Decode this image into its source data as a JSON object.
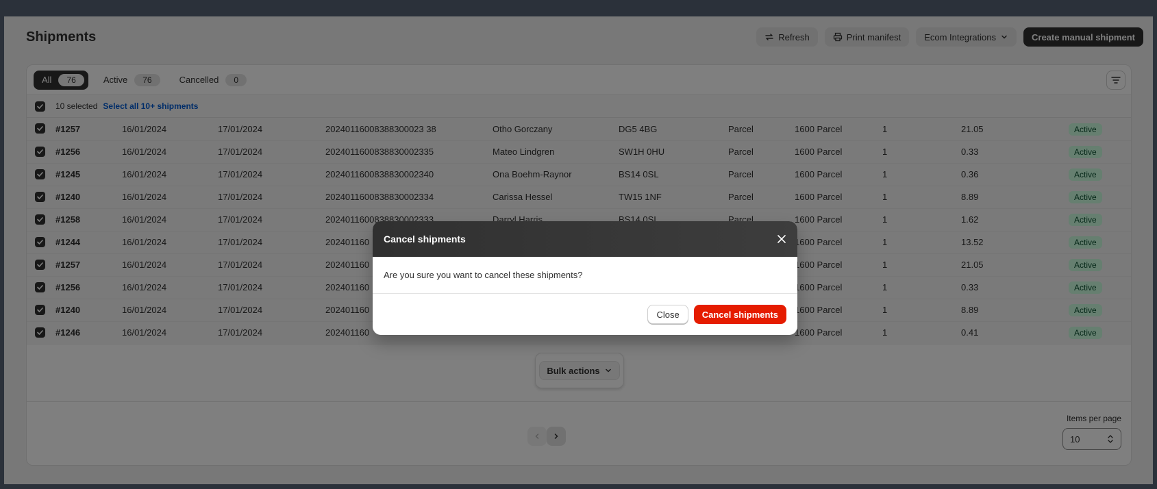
{
  "page": {
    "title": "Shipments"
  },
  "header": {
    "refresh_label": "Refresh",
    "print_label": "Print manifest",
    "integrations_label": "Ecom Integrations",
    "create_label": "Create manual shipment"
  },
  "tabs": [
    {
      "label": "All",
      "count": "76"
    },
    {
      "label": "Active",
      "count": "76"
    },
    {
      "label": "Cancelled",
      "count": "0"
    }
  ],
  "selection": {
    "selected_text": "10 selected",
    "select_all_label": "Select all 10+ shipments"
  },
  "rows": [
    {
      "order": "#1257",
      "created": "16/01/2024",
      "date": "17/01/2024",
      "tracking": "20240116008388300023 38",
      "customer": "Otho Gorczany",
      "postcode": "DG5 4BG",
      "type": "Parcel",
      "service": "1600 Parcel",
      "qty": "1",
      "weight": "21.05",
      "status": "Active"
    },
    {
      "order": "#1256",
      "created": "16/01/2024",
      "date": "17/01/2024",
      "tracking": "2024011600838830002335",
      "customer": "Mateo Lindgren",
      "postcode": "SW1H 0HU",
      "type": "Parcel",
      "service": "1600 Parcel",
      "qty": "1",
      "weight": "0.33",
      "status": "Active"
    },
    {
      "order": "#1245",
      "created": "16/01/2024",
      "date": "17/01/2024",
      "tracking": "2024011600838830002340",
      "customer": "Ona Boehm-Raynor",
      "postcode": "BS14 0SL",
      "type": "Parcel",
      "service": "1600 Parcel",
      "qty": "1",
      "weight": "0.36",
      "status": "Active"
    },
    {
      "order": "#1240",
      "created": "16/01/2024",
      "date": "17/01/2024",
      "tracking": "2024011600838830002334",
      "customer": "Carissa Hessel",
      "postcode": "TW15 1NF",
      "type": "Parcel",
      "service": "1600 Parcel",
      "qty": "1",
      "weight": "8.89",
      "status": "Active"
    },
    {
      "order": "#1258",
      "created": "16/01/2024",
      "date": "17/01/2024",
      "tracking": "2024011600838830002333",
      "customer": "Darryl Harris",
      "postcode": "BS14 0SL",
      "type": "Parcel",
      "service": "1600 Parcel",
      "qty": "1",
      "weight": "1.62",
      "status": "Active"
    },
    {
      "order": "#1244",
      "created": "16/01/2024",
      "date": "17/01/2024",
      "tracking": "202401160",
      "customer": "",
      "postcode": "",
      "type": "",
      "service": "1600 Parcel",
      "qty": "1",
      "weight": "13.52",
      "status": "Active"
    },
    {
      "order": "#1257",
      "created": "16/01/2024",
      "date": "17/01/2024",
      "tracking": "202401160",
      "customer": "",
      "postcode": "",
      "type": "",
      "service": "1600 Parcel",
      "qty": "1",
      "weight": "21.05",
      "status": "Active"
    },
    {
      "order": "#1256",
      "created": "16/01/2024",
      "date": "17/01/2024",
      "tracking": "202401160",
      "customer": "",
      "postcode": "",
      "type": "",
      "service": "1600 Parcel",
      "qty": "1",
      "weight": "0.33",
      "status": "Active"
    },
    {
      "order": "#1240",
      "created": "16/01/2024",
      "date": "17/01/2024",
      "tracking": "202401160",
      "customer": "",
      "postcode": "",
      "type": "",
      "service": "1600 Parcel",
      "qty": "1",
      "weight": "8.89",
      "status": "Active"
    },
    {
      "order": "#1246",
      "created": "16/01/2024",
      "date": "17/01/2024",
      "tracking": "202401160",
      "customer": "",
      "postcode": "",
      "type": "",
      "service": "1600 Parcel",
      "qty": "1",
      "weight": "0.41",
      "status": "Active"
    }
  ],
  "bulk": {
    "label": "Bulk actions"
  },
  "pagination": {
    "items_per_page_label": "Items per page",
    "items_per_page": "10"
  },
  "modal": {
    "title": "Cancel shipments",
    "message": "Are you sure you want to cancel these shipments?",
    "close_label": "Close",
    "confirm_label": "Cancel shipments"
  },
  "colors": {
    "primary_dark": "#303030",
    "critical": "#e51c00",
    "link": "#005bd3",
    "status_active_bg": "#cdfee1"
  }
}
